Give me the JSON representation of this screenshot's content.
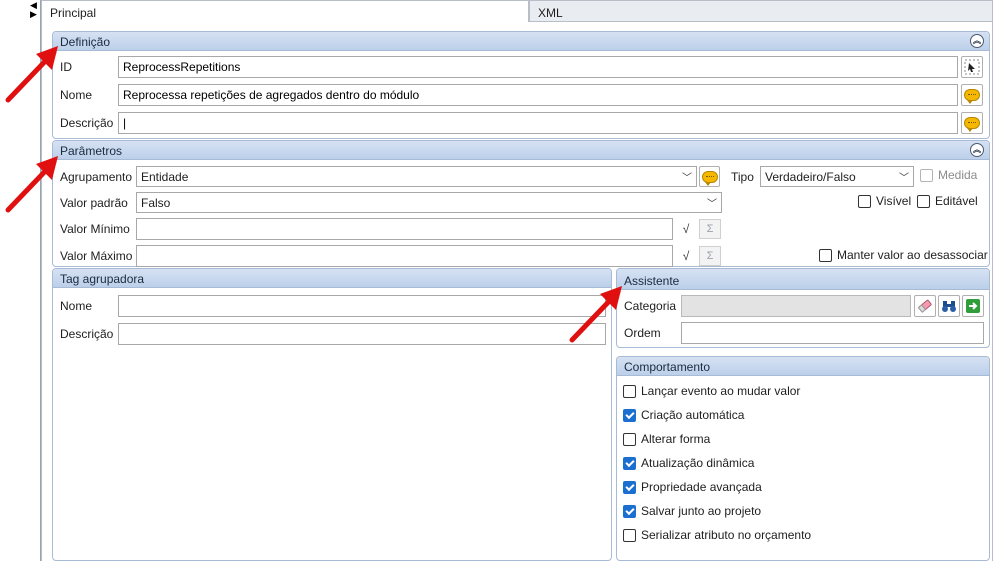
{
  "tabs": [
    {
      "label": "Principal"
    },
    {
      "label": "XML"
    }
  ],
  "definicao": {
    "title": "Definição",
    "id_label": "ID",
    "id_value": "ReprocessRepetitions",
    "nome_label": "Nome",
    "nome_value": "Reprocessa repetições de agregados dentro do módulo",
    "descricao_label": "Descrição",
    "descricao_value": "|"
  },
  "parametros": {
    "title": "Parâmetros",
    "agrupamento_label": "Agrupamento",
    "agrupamento_value": "Entidade",
    "tipo_label": "Tipo",
    "tipo_value": "Verdadeiro/Falso",
    "medida_label": "Medida",
    "valor_padrao_label": "Valor padrão",
    "valor_padrao_value": "Falso",
    "visivel_label": "Visível",
    "editavel_label": "Editável",
    "valor_minimo_label": "Valor Mínimo",
    "valor_maximo_label": "Valor Máximo",
    "manter_label": "Manter valor ao desassociar",
    "sigma_glyph": "Σ",
    "sqrt_glyph": "√"
  },
  "tag_agrupadora": {
    "title": "Tag agrupadora",
    "nome_label": "Nome",
    "descricao_label": "Descrição"
  },
  "assistente": {
    "title": "Assistente",
    "categoria_label": "Categoria",
    "ordem_label": "Ordem"
  },
  "comportamento": {
    "title": "Comportamento",
    "items": [
      {
        "label": "Lançar evento ao mudar valor",
        "checked": false
      },
      {
        "label": "Criação automática",
        "checked": true
      },
      {
        "label": "Alterar forma",
        "checked": false
      },
      {
        "label": "Atualização dinâmica",
        "checked": true
      },
      {
        "label": "Propriedade avançada",
        "checked": true
      },
      {
        "label": "Salvar junto ao projeto",
        "checked": true
      },
      {
        "label": "Serializar atributo no orçamento",
        "checked": false
      }
    ]
  },
  "colors": {
    "accent": "#1a6fd0",
    "group_header": "#c9d9ef",
    "annotation": "#e01010"
  },
  "icons": [
    "collapse-up-icon",
    "chat-balloon-icon",
    "select-id-icon",
    "eraser-icon",
    "binoculars-icon",
    "go-green-arrow-icon",
    "sqrt-icon",
    "sigma-icon",
    "chevron-down-icon",
    "annotation-arrow-icon"
  ]
}
